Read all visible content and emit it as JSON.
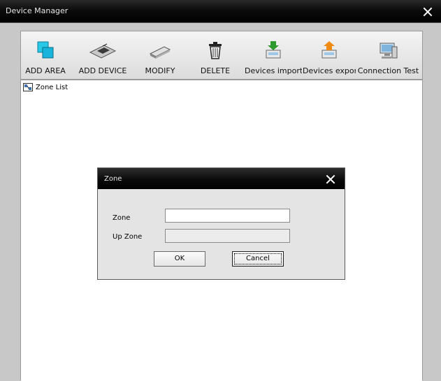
{
  "window": {
    "title": "Device Manager"
  },
  "toolbar": {
    "items": [
      {
        "label": "ADD AREA",
        "icon": "add-area-icon"
      },
      {
        "label": "ADD DEVICE",
        "icon": "add-device-icon"
      },
      {
        "label": "MODIFY",
        "icon": "modify-icon"
      },
      {
        "label": "DELETE",
        "icon": "trash-icon"
      },
      {
        "label": "Devices import",
        "icon": "import-icon"
      },
      {
        "label": "Devices export",
        "icon": "export-icon"
      },
      {
        "label": "Connection Test",
        "icon": "connection-test-icon"
      }
    ]
  },
  "tree": {
    "root_label": "Zone List"
  },
  "dialog": {
    "title": "Zone",
    "zone_label": "Zone",
    "zone_value": "",
    "upzone_label": "Up Zone",
    "upzone_value": "",
    "ok_label": "OK",
    "cancel_label": "Cancel"
  },
  "colors": {
    "titlebar": "#000000",
    "accent_green": "#2e9a2e",
    "accent_orange": "#f08a12",
    "icon_cyan": "#1fc8e0"
  }
}
